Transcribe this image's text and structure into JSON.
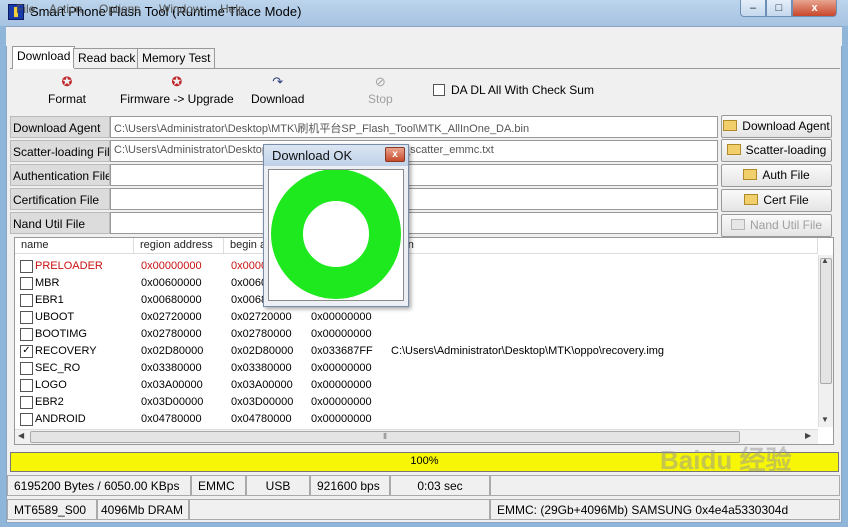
{
  "window": {
    "title": "Smart Phone Flash Tool (Runtime Trace Mode)",
    "min": "–",
    "max": "□",
    "close": "x"
  },
  "menu": [
    "File",
    "Action",
    "Options",
    "Window",
    "Help"
  ],
  "tabs": [
    "Download",
    "Read back",
    "Memory Test"
  ],
  "toolbar": {
    "format": "Format",
    "upgrade": "Firmware -> Upgrade",
    "download": "Download",
    "stop": "Stop",
    "checksum": "DA DL All With Check Sum",
    "icons": {
      "format": "format-icon",
      "upgrade": "upgrade-icon",
      "download": "download-icon",
      "stop": "stop-icon"
    }
  },
  "files": [
    {
      "label": "Download Agent",
      "value": "C:\\Users\\Administrator\\Desktop\\MTK\\刷机平台SP_Flash_Tool\\MTK_AllInOne_DA.bin",
      "button": "Download Agent",
      "enabled": true
    },
    {
      "label": "Scatter-loading File",
      "value": "C:\\Users\\Administrator\\Desktop\\",
      "value_tail": "_scatter_emmc.txt",
      "button": "Scatter-loading",
      "enabled": true
    },
    {
      "label": "Authentication File",
      "value": "",
      "button": "Auth File",
      "enabled": true
    },
    {
      "label": "Certification File",
      "value": "",
      "button": "Cert File",
      "enabled": true
    },
    {
      "label": "Nand Util File",
      "value": "",
      "button": "Nand Util File",
      "enabled": false
    }
  ],
  "table": {
    "headers": {
      "name": "name",
      "region": "region address",
      "begin": "begin a",
      "location": "ation"
    },
    "rows": [
      {
        "name": "PRELOADER",
        "region": "0x00000000",
        "begin": "0x0000",
        "end": "",
        "location": "",
        "checked": false,
        "red": true
      },
      {
        "name": "MBR",
        "region": "0x00600000",
        "begin": "0x0060",
        "end": "",
        "location": "",
        "checked": false,
        "red": false
      },
      {
        "name": "EBR1",
        "region": "0x00680000",
        "begin": "0x0068",
        "end": "",
        "location": "",
        "checked": false,
        "red": false
      },
      {
        "name": "UBOOT",
        "region": "0x02720000",
        "begin": "0x02720000",
        "end": "0x00000000",
        "location": "",
        "checked": false,
        "red": false
      },
      {
        "name": "BOOTIMG",
        "region": "0x02780000",
        "begin": "0x02780000",
        "end": "0x00000000",
        "location": "",
        "checked": false,
        "red": false
      },
      {
        "name": "RECOVERY",
        "region": "0x02D80000",
        "begin": "0x02D80000",
        "end": "0x033687FF",
        "location": "C:\\Users\\Administrator\\Desktop\\MTK\\oppo\\recovery.img",
        "checked": true,
        "red": false
      },
      {
        "name": "SEC_RO",
        "region": "0x03380000",
        "begin": "0x03380000",
        "end": "0x00000000",
        "location": "",
        "checked": false,
        "red": false
      },
      {
        "name": "LOGO",
        "region": "0x03A00000",
        "begin": "0x03A00000",
        "end": "0x00000000",
        "location": "",
        "checked": false,
        "red": false
      },
      {
        "name": "EBR2",
        "region": "0x03D00000",
        "begin": "0x03D00000",
        "end": "0x00000000",
        "location": "",
        "checked": false,
        "red": false
      },
      {
        "name": "ANDROID",
        "region": "0x04780000",
        "begin": "0x04780000",
        "end": "0x00000000",
        "location": "",
        "checked": false,
        "red": false
      }
    ]
  },
  "progress": {
    "value": 1.0,
    "label": "100%",
    "color": "#f6f606"
  },
  "status1": {
    "speed": "6195200 Bytes / 6050.00 KBps",
    "storage": "EMMC",
    "port": "USB",
    "baud": "921600 bps",
    "time": "0:03 sec"
  },
  "status2": {
    "chip": "MT6589_S00",
    "dram": "4096Mb DRAM",
    "emmc": "EMMC: (29Gb+4096Mb) SAMSUNG 0x4e4a5330304d"
  },
  "dialog": {
    "title": "Download OK",
    "close": "x",
    "ring_color": "#1ee81e"
  },
  "watermark": "Baidu 经验"
}
